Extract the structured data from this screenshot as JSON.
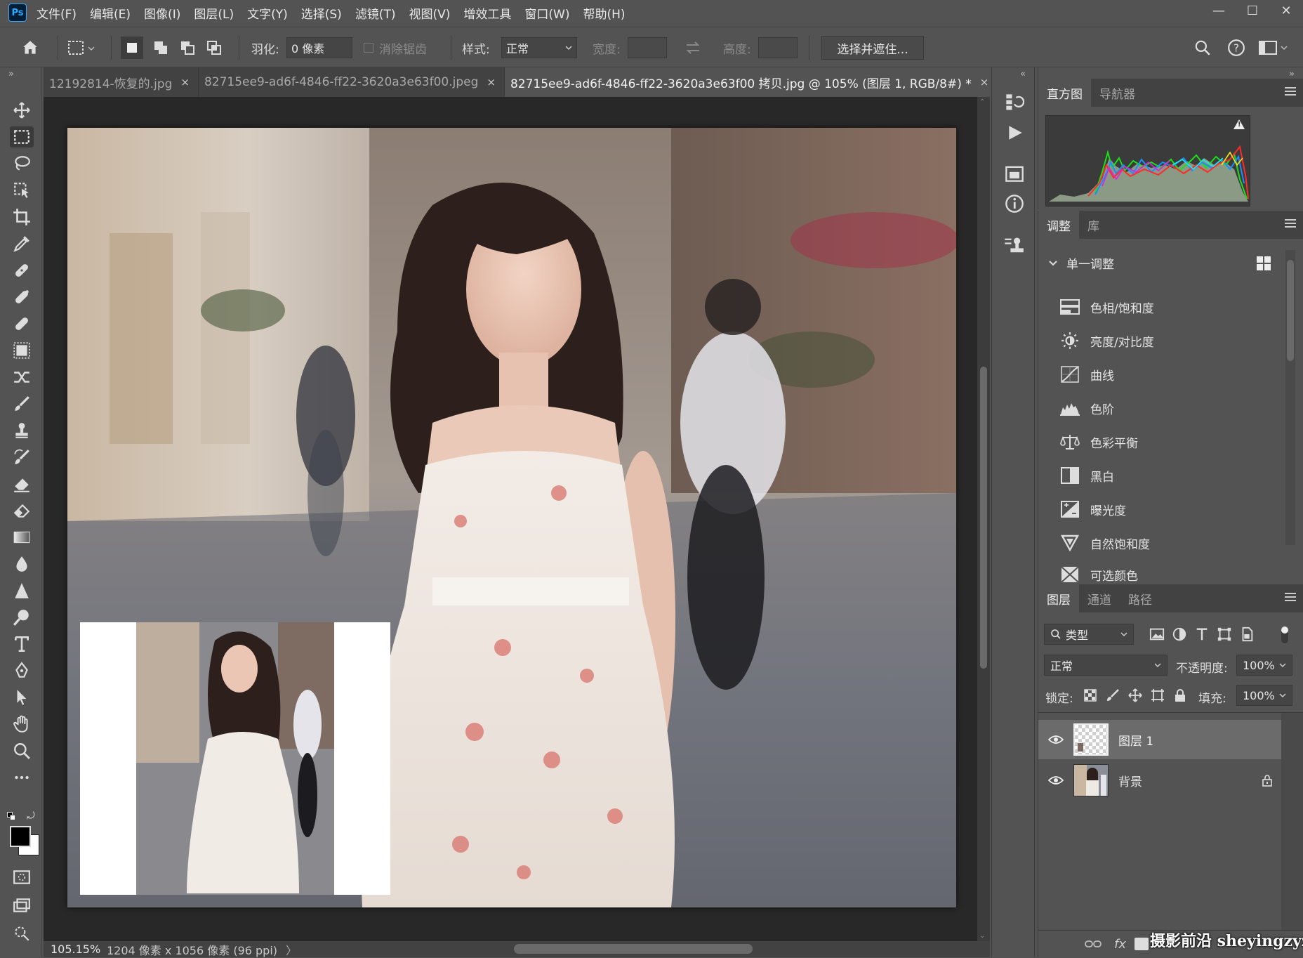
{
  "app": {
    "logo": "Ps"
  },
  "menu": [
    "文件(F)",
    "编辑(E)",
    "图像(I)",
    "图层(L)",
    "文字(Y)",
    "选择(S)",
    "滤镜(T)",
    "视图(V)",
    "增效工具",
    "窗口(W)",
    "帮助(H)"
  ],
  "window_controls": {
    "minimize": "—",
    "maximize": "☐",
    "close": "✕"
  },
  "options_bar": {
    "feather_label": "羽化:",
    "feather_value": "0 像素",
    "antialias_label": "消除锯齿",
    "style_label": "样式:",
    "style_value": "正常",
    "width_label": "宽度:",
    "height_label": "高度:",
    "select_mask_button": "选择并遮住..."
  },
  "tabs": [
    {
      "label": "12192814-恢复的.jpg",
      "close": "×"
    },
    {
      "label": "82715ee9-ad6f-4846-ff22-3620a3e63f00.jpeg",
      "close": "×"
    },
    {
      "label": "82715ee9-ad6f-4846-ff22-3620a3e63f00 拷贝.jpg @ 105% (图层 1, RGB/8#) *",
      "close": "×"
    }
  ],
  "tabs_overflow": "»",
  "status": {
    "zoom": "105.15%",
    "dimensions": "1204 像素 x 1056 像素 (96 ppi)",
    "arrow": "〉"
  },
  "histogram_panel": {
    "tabs": [
      "直方图",
      "导航器"
    ],
    "warning": "!"
  },
  "adjustments_panel": {
    "tabs": [
      "调整",
      "库"
    ],
    "section": "单一调整",
    "items": [
      "色相/饱和度",
      "亮度/对比度",
      "曲线",
      "色阶",
      "色彩平衡",
      "黑白",
      "曝光度",
      "自然饱和度",
      "可选颜色"
    ]
  },
  "layers_panel": {
    "tabs": [
      "图层",
      "通道",
      "路径"
    ],
    "filter_label": "类型",
    "blend_mode": "正常",
    "opacity_label": "不透明度:",
    "opacity_value": "100%",
    "lock_label": "锁定:",
    "fill_label": "填充:",
    "fill_value": "100%",
    "layers": [
      {
        "name": "图层 1",
        "selected": true
      },
      {
        "name": "背景",
        "locked": true
      }
    ],
    "footer": {
      "fx": "fx"
    }
  },
  "watermark": "摄影前沿 sheyingzyz.com",
  "colors": {
    "accent": "#31a8ff",
    "panel_bg": "#535353",
    "dark_bg": "#424242",
    "canvas_bg": "#282828"
  }
}
